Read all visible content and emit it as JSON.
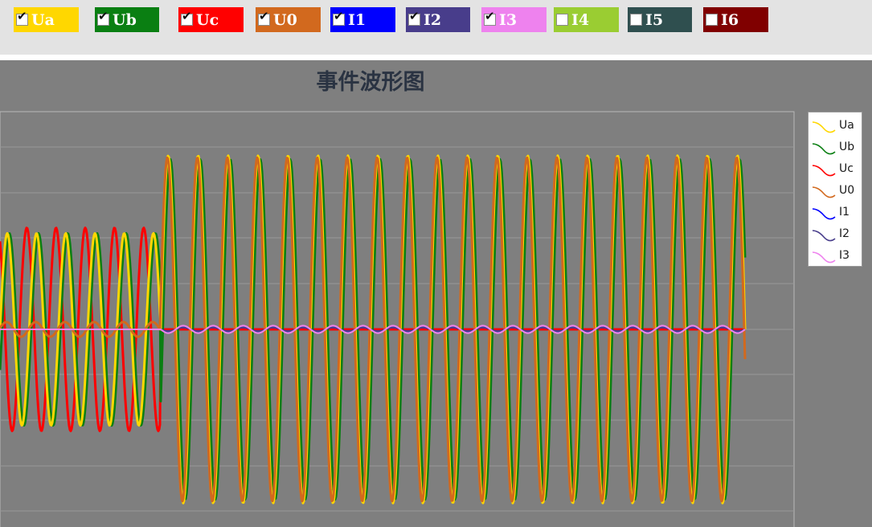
{
  "toolbar": {
    "checkboxes": [
      {
        "label": "Ua",
        "checked": true,
        "color": "#ffd700"
      },
      {
        "label": "Ub",
        "checked": true,
        "color": "#0a7f12"
      },
      {
        "label": "Uc",
        "checked": true,
        "color": "#ff0000"
      },
      {
        "label": "U0",
        "checked": true,
        "color": "#d2691e"
      },
      {
        "label": "I1",
        "checked": true,
        "color": "#0000ff"
      },
      {
        "label": "I2",
        "checked": true,
        "color": "#483d8b"
      },
      {
        "label": "I3",
        "checked": true,
        "color": "#ee82ee"
      },
      {
        "label": "I4",
        "checked": false,
        "color": "#9acd32"
      },
      {
        "label": "I5",
        "checked": false,
        "color": "#2f4f4f"
      },
      {
        "label": "I6",
        "checked": false,
        "color": "#800000"
      }
    ]
  },
  "chart_data": {
    "type": "line",
    "title": "事件波形图",
    "grid": "horizontal",
    "legend_position": "right",
    "series": [
      {
        "name": "Ua",
        "color": "#ffd700",
        "cycles_pre": 5.5,
        "amp_pre": 0.52,
        "amp_post": 0.94,
        "phase_deg": 0
      },
      {
        "name": "Ub",
        "color": "#0a7f12",
        "cycles_pre": 5.5,
        "amp_pre": 0.52,
        "amp_post": 0.92,
        "phase_deg": -25
      },
      {
        "name": "Uc",
        "color": "#ff0000",
        "cycles_pre": 5.5,
        "amp_pre": 0.55,
        "amp_post": 0.0,
        "phase_deg": 120
      },
      {
        "name": "U0",
        "color": "#d2691e",
        "cycles_pre": 5.5,
        "amp_pre": 0.04,
        "amp_post": 0.93,
        "phase_deg": 10
      },
      {
        "name": "I1",
        "color": "#0000ff",
        "amp_pre": 0.0,
        "amp_post": 0.01
      },
      {
        "name": "I2",
        "color": "#483d8b",
        "amp_pre": 0.0,
        "amp_post": 0.01
      },
      {
        "name": "I3",
        "color": "#ee82ee",
        "amp_pre": 0.0,
        "amp_post": 0.02
      }
    ],
    "events": {
      "step_fraction": 0.22,
      "cycles_pre": 5.5,
      "cycles_post": 19.5
    }
  }
}
